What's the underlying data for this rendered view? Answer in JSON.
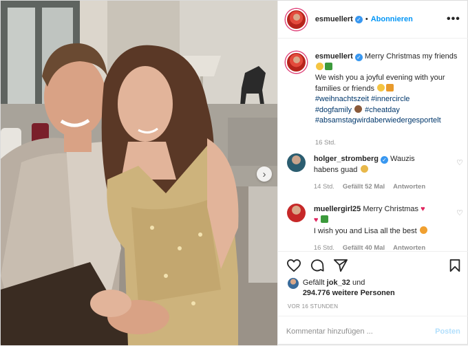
{
  "header": {
    "username": "esmuellert",
    "dot": "•",
    "follow_label": "Abonnieren",
    "more_label": "•••"
  },
  "caption": {
    "username": "esmuellert",
    "text_line1": "Merry Christmas my friends",
    "text_line2": "We wish you a joyful evening with your families or friends",
    "hashtags": [
      "#weihnachtszeit",
      "#innercircle",
      "#dogfamily",
      "#cheatday",
      "#absamstagwirdaberwiedergesportelt"
    ],
    "time": "16 Std."
  },
  "comments": [
    {
      "username": "holger_stromberg",
      "verified": true,
      "text": "Wauzis habens guad",
      "time": "14 Std.",
      "likes": "Gefällt 52 Mal",
      "reply": "Antworten"
    },
    {
      "username": "muellergirl25",
      "verified": false,
      "text_line1": "Merry Christmas",
      "text_line2": "I wish you and Lisa all the best",
      "time": "16 Std.",
      "likes": "Gefällt 40 Mal",
      "reply": "Antworten"
    }
  ],
  "likes": {
    "prefix": "Gefällt",
    "user": "jok_32",
    "conj": "und",
    "others": "294.776 weitere Personen"
  },
  "time_ago": "VOR 16 STUNDEN",
  "comment_input": {
    "placeholder": "Kommentar hinzufügen ...",
    "post_label": "Posten"
  },
  "colors": {
    "accent": "#0095f6",
    "verified": "#3897f0",
    "hashtag": "#00376b"
  },
  "icons": [
    "heart-icon",
    "comment-icon",
    "share-icon",
    "bookmark-icon",
    "verified-icon",
    "chevron-right-icon",
    "more-icon"
  ]
}
